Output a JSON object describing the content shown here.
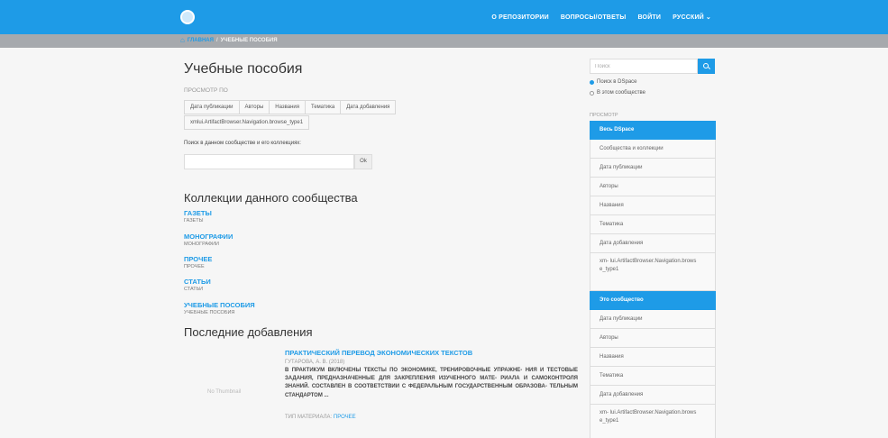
{
  "topbar": {
    "nav": [
      "О РЕПОЗИТОРИИ",
      "ВОПРОСЫ/ОТВЕТЫ",
      "ВОЙТИ",
      "РУССКИЙ"
    ],
    "caret": "⌄"
  },
  "breadcrumb": {
    "home": "ГЛАВНАЯ",
    "separator": "/",
    "current": "УЧЕБНЫЕ ПОСОБИЯ"
  },
  "main": {
    "title": "Учебные пособия",
    "browse_label": "ПРОСМОТР ПО",
    "browse_buttons": [
      "Дата публикации",
      "Авторы",
      "Названия",
      "Тематика",
      "Дата добавления"
    ],
    "browse_buttons_row2": [
      "xmlui.ArtifactBrowser.Navigation.browse_type1"
    ],
    "search_label": "Поиск в данном сообществе и его коллекциях:",
    "search_value": "",
    "ok_label": "Ok",
    "collections_title": "Коллекции данного сообщества",
    "collections": [
      {
        "name": "ГАЗЕТЫ",
        "sub": "ГАЗЕТЫ"
      },
      {
        "name": "МОНОГРАФИИ",
        "sub": "МОНОГРАФИИ"
      },
      {
        "name": "ПРОЧЕЕ",
        "sub": "ПРОЧЕЕ"
      },
      {
        "name": "СТАТЬИ",
        "sub": "СТАТЬИ"
      },
      {
        "name": "УЧЕБНЫЕ ПОСОБИЯ",
        "sub": "УЧЕБНЫЕ ПОСОБИЯ"
      }
    ],
    "recent_title": "Последние добавления",
    "recent_item": {
      "thumbnail": "No Thumbnail",
      "title": "ПРАКТИЧЕСКИЙ ПЕРЕВОД ЭКОНОМИЧЕСКИХ ТЕКСТОВ",
      "author": "ГУТАРОВА, А. В. (2018)",
      "abstract": "В ПРАКТИКУМ ВКЛЮЧЕНЫ ТЕКСТЫ ПО ЭКОНОМИКЕ, ТРЕНИРОВОЧНЫЕ УПРАЖНЕ- НИЯ И ТЕСТОВЫЕ ЗАДАНИЯ, ПРЕДНАЗНАЧЕННЫЕ ДЛЯ ЗАКРЕПЛЕНИЯ ИЗУЧЕННОГО МАТЕ- РИАЛА И САМОКОНТРОЛЯ ЗНАНИЙ. СОСТАВЛЕН В СООТВЕТСТВИИ С ФЕДЕРАЛЬНЫМ ГОСУДАРСТВЕННЫМ ОБРАЗОВА- ТЕЛЬНЫМ СТАНДАРТОМ ...",
      "type_label": "ТИП МАТЕРИАЛА:",
      "type_value": "ПРОЧЕЕ"
    }
  },
  "sidebar": {
    "search_placeholder": "Поиск",
    "radio_options": [
      "Поиск в DSpace",
      "В этом сообществе"
    ],
    "browse_label": "ПРОСМОТР",
    "all_dspace": {
      "header": "Весь DSpace",
      "items": [
        "Сообщества и коллекции",
        "Дата публикации",
        "Авторы",
        "Названия",
        "Тематика",
        "Дата добавления",
        "xm- lui.ArtifactBrowser.Navigation.brows e_type1"
      ]
    },
    "this_community": {
      "header": "Это сообщество",
      "items": [
        "Дата публикации",
        "Авторы",
        "Названия",
        "Тематика",
        "Дата добавления",
        "xm- lui.ArtifactBrowser.Navigation.brows e_type1"
      ]
    }
  },
  "colors": {
    "accent": "#1e9be7",
    "crumbbar": "#a6a9ad",
    "background": "#f6f6f6"
  }
}
